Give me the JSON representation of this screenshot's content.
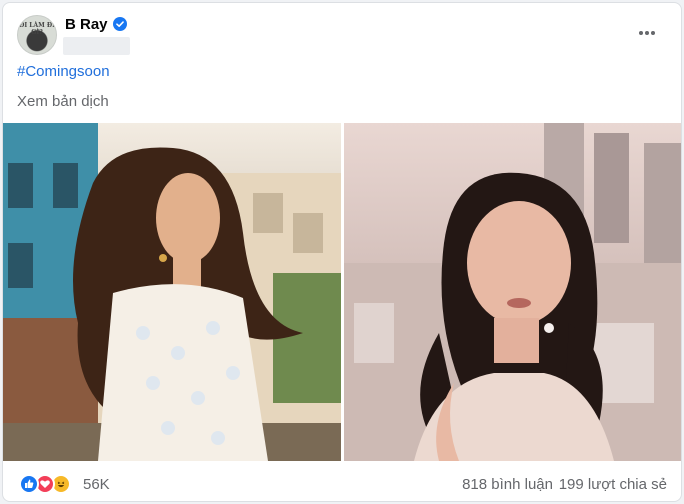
{
  "post": {
    "author": "B Ray",
    "verified_icon": "verified-badge-icon",
    "avatar_text": "ĐI LÀM ĐI GÌ?",
    "more_icon": "more-options-icon",
    "hashtag": "#Comingsoon",
    "translate_label": "Xem bản dịch"
  },
  "photos": [
    {
      "name": "photo-left",
      "subject": "woman in sheer polka-dot blouse, colorful buildings background"
    },
    {
      "name": "photo-right",
      "subject": "woman with pigtails, city skyline at sunset background"
    }
  ],
  "stats": {
    "reaction_icons": [
      "like-icon",
      "love-icon",
      "haha-icon"
    ],
    "reaction_count": "56K",
    "comments": "818 bình luận",
    "shares": "199 lượt chia sẻ"
  },
  "colors": {
    "link": "#216fdb",
    "secondary_text": "#65676b",
    "verified": "#1877f2"
  }
}
